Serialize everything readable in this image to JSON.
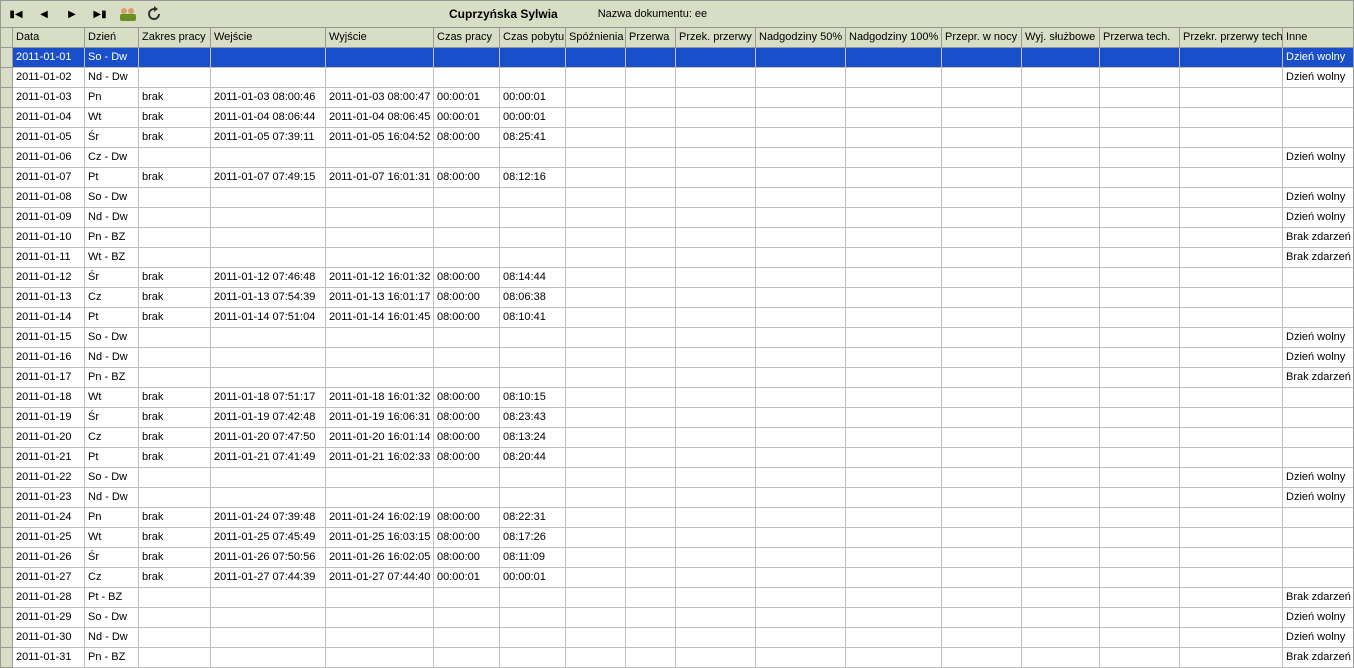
{
  "toolbar": {
    "title": "Cuprzyńska Sylwia",
    "doc_label": "Nazwa dokumentu: ee"
  },
  "columns": [
    {
      "key": "data",
      "label": "Data",
      "cls": "c-data"
    },
    {
      "key": "dzien",
      "label": "Dzień",
      "cls": "c-dzien"
    },
    {
      "key": "zakres",
      "label": "Zakres pracy",
      "cls": "c-zakres"
    },
    {
      "key": "wejscie",
      "label": "Wejście",
      "cls": "c-wejscie"
    },
    {
      "key": "wyjscie",
      "label": "Wyjście",
      "cls": "c-wyjscie"
    },
    {
      "key": "czaspracy",
      "label": "Czas pracy",
      "cls": "c-czaspracy"
    },
    {
      "key": "czaspobytu",
      "label": "Czas pobytu",
      "cls": "c-czaspobytu"
    },
    {
      "key": "spoznienia",
      "label": "Spóźnienia",
      "cls": "c-spoznienia"
    },
    {
      "key": "przerwa",
      "label": "Przerwa",
      "cls": "c-przerwa"
    },
    {
      "key": "przekprzerwy",
      "label": "Przek. przerwy",
      "cls": "c-przekprzerwy"
    },
    {
      "key": "nad50",
      "label": "Nadgodziny 50%",
      "cls": "c-nad50"
    },
    {
      "key": "nad100",
      "label": "Nadgodziny 100%",
      "cls": "c-nad100"
    },
    {
      "key": "wnocy",
      "label": "Przepr. w nocy",
      "cls": "c-wnocy"
    },
    {
      "key": "wyjsluz",
      "label": "Wyj. służbowe",
      "cls": "c-wyjsluz"
    },
    {
      "key": "przerwatech",
      "label": "Przerwa tech.",
      "cls": "c-przerwatech"
    },
    {
      "key": "przekrtech",
      "label": "Przekr. przerwy tech.",
      "cls": "c-przekrtech"
    },
    {
      "key": "inne",
      "label": "Inne",
      "cls": "c-inne"
    }
  ],
  "rows": [
    {
      "data": "2011-01-01",
      "dzien": "So - Dw",
      "inne": "Dzień wolny",
      "selected": true
    },
    {
      "data": "2011-01-02",
      "dzien": "Nd - Dw",
      "inne": "Dzień wolny"
    },
    {
      "data": "2011-01-03",
      "dzien": "Pn",
      "zakres": "brak",
      "wejscie": "2011-01-03 08:00:46",
      "wyjscie": "2011-01-03 08:00:47",
      "czaspracy": "00:00:01",
      "czaspobytu": "00:00:01"
    },
    {
      "data": "2011-01-04",
      "dzien": "Wt",
      "zakres": "brak",
      "wejscie": "2011-01-04 08:06:44",
      "wyjscie": "2011-01-04 08:06:45",
      "czaspracy": "00:00:01",
      "czaspobytu": "00:00:01"
    },
    {
      "data": "2011-01-05",
      "dzien": "Śr",
      "zakres": "brak",
      "wejscie": "2011-01-05 07:39:11",
      "wyjscie": "2011-01-05 16:04:52",
      "czaspracy": "08:00:00",
      "czaspobytu": "08:25:41"
    },
    {
      "data": "2011-01-06",
      "dzien": "Cz - Dw",
      "inne": "Dzień wolny"
    },
    {
      "data": "2011-01-07",
      "dzien": "Pt",
      "zakres": "brak",
      "wejscie": "2011-01-07 07:49:15",
      "wyjscie": "2011-01-07 16:01:31",
      "czaspracy": "08:00:00",
      "czaspobytu": "08:12:16"
    },
    {
      "data": "2011-01-08",
      "dzien": "So - Dw",
      "inne": "Dzień wolny"
    },
    {
      "data": "2011-01-09",
      "dzien": "Nd - Dw",
      "inne": "Dzień wolny"
    },
    {
      "data": "2011-01-10",
      "dzien": "Pn - BZ",
      "inne": "Brak zdarzeń"
    },
    {
      "data": "2011-01-11",
      "dzien": "Wt - BZ",
      "inne": "Brak zdarzeń"
    },
    {
      "data": "2011-01-12",
      "dzien": "Śr",
      "zakres": "brak",
      "wejscie": "2011-01-12 07:46:48",
      "wyjscie": "2011-01-12 16:01:32",
      "czaspracy": "08:00:00",
      "czaspobytu": "08:14:44"
    },
    {
      "data": "2011-01-13",
      "dzien": "Cz",
      "zakres": "brak",
      "wejscie": "2011-01-13 07:54:39",
      "wyjscie": "2011-01-13 16:01:17",
      "czaspracy": "08:00:00",
      "czaspobytu": "08:06:38"
    },
    {
      "data": "2011-01-14",
      "dzien": "Pt",
      "zakres": "brak",
      "wejscie": "2011-01-14 07:51:04",
      "wyjscie": "2011-01-14 16:01:45",
      "czaspracy": "08:00:00",
      "czaspobytu": "08:10:41"
    },
    {
      "data": "2011-01-15",
      "dzien": "So - Dw",
      "inne": "Dzień wolny"
    },
    {
      "data": "2011-01-16",
      "dzien": "Nd - Dw",
      "inne": "Dzień wolny"
    },
    {
      "data": "2011-01-17",
      "dzien": "Pn - BZ",
      "inne": "Brak zdarzeń"
    },
    {
      "data": "2011-01-18",
      "dzien": "Wt",
      "zakres": "brak",
      "wejscie": "2011-01-18 07:51:17",
      "wyjscie": "2011-01-18 16:01:32",
      "czaspracy": "08:00:00",
      "czaspobytu": "08:10:15"
    },
    {
      "data": "2011-01-19",
      "dzien": "Śr",
      "zakres": "brak",
      "wejscie": "2011-01-19 07:42:48",
      "wyjscie": "2011-01-19 16:06:31",
      "czaspracy": "08:00:00",
      "czaspobytu": "08:23:43"
    },
    {
      "data": "2011-01-20",
      "dzien": "Cz",
      "zakres": "brak",
      "wejscie": "2011-01-20 07:47:50",
      "wyjscie": "2011-01-20 16:01:14",
      "czaspracy": "08:00:00",
      "czaspobytu": "08:13:24"
    },
    {
      "data": "2011-01-21",
      "dzien": "Pt",
      "zakres": "brak",
      "wejscie": "2011-01-21 07:41:49",
      "wyjscie": "2011-01-21 16:02:33",
      "czaspracy": "08:00:00",
      "czaspobytu": "08:20:44"
    },
    {
      "data": "2011-01-22",
      "dzien": "So - Dw",
      "inne": "Dzień wolny"
    },
    {
      "data": "2011-01-23",
      "dzien": "Nd - Dw",
      "inne": "Dzień wolny"
    },
    {
      "data": "2011-01-24",
      "dzien": "Pn",
      "zakres": "brak",
      "wejscie": "2011-01-24 07:39:48",
      "wyjscie": "2011-01-24 16:02:19",
      "czaspracy": "08:00:00",
      "czaspobytu": "08:22:31"
    },
    {
      "data": "2011-01-25",
      "dzien": "Wt",
      "zakres": "brak",
      "wejscie": "2011-01-25 07:45:49",
      "wyjscie": "2011-01-25 16:03:15",
      "czaspracy": "08:00:00",
      "czaspobytu": "08:17:26"
    },
    {
      "data": "2011-01-26",
      "dzien": "Śr",
      "zakres": "brak",
      "wejscie": "2011-01-26 07:50:56",
      "wyjscie": "2011-01-26 16:02:05",
      "czaspracy": "08:00:00",
      "czaspobytu": "08:11:09"
    },
    {
      "data": "2011-01-27",
      "dzien": "Cz",
      "zakres": "brak",
      "wejscie": "2011-01-27 07:44:39",
      "wyjscie": "2011-01-27 07:44:40",
      "czaspracy": "00:00:01",
      "czaspobytu": "00:00:01"
    },
    {
      "data": "2011-01-28",
      "dzien": "Pt - BZ",
      "inne": "Brak zdarzeń"
    },
    {
      "data": "2011-01-29",
      "dzien": "So - Dw",
      "inne": "Dzień wolny"
    },
    {
      "data": "2011-01-30",
      "dzien": "Nd - Dw",
      "inne": "Dzień wolny"
    },
    {
      "data": "2011-01-31",
      "dzien": "Pn - BZ",
      "inne": "Brak zdarzeń"
    }
  ]
}
